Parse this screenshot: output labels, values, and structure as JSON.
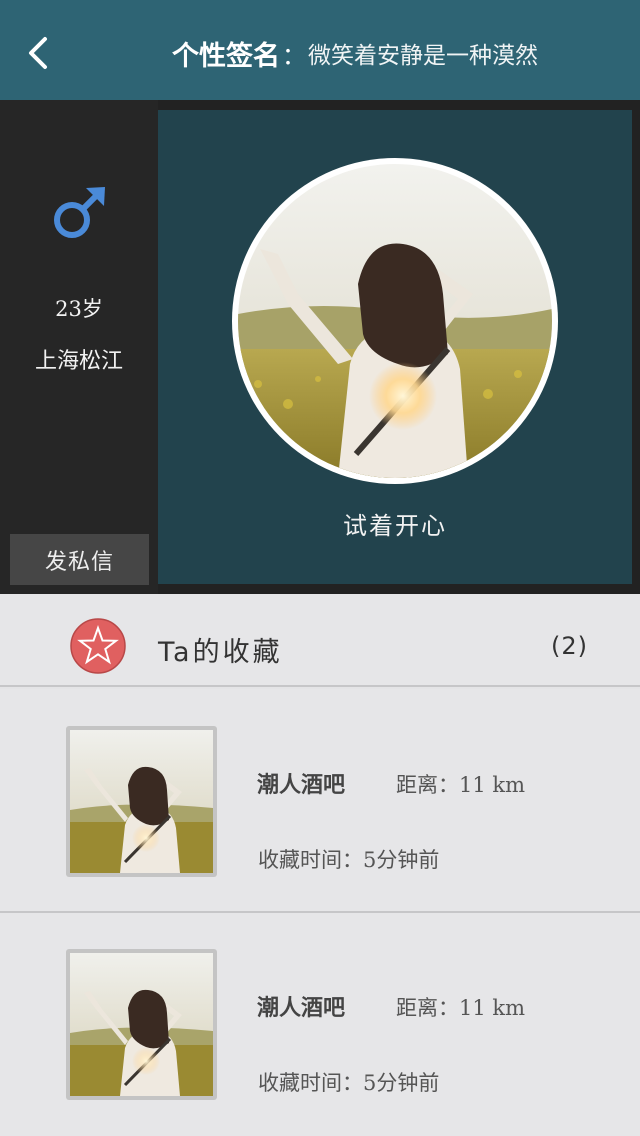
{
  "header": {
    "back_icon": "chevron-left-icon",
    "signature_label": "个性签名",
    "signature_colon": "：",
    "signature_text": "微笑着安静是一种漠然"
  },
  "profile": {
    "gender_icon": "male-icon",
    "gender_color": "#4a8ad8",
    "age": "23岁",
    "location": "上海松江",
    "message_button": "发私信",
    "motto": "试着开心"
  },
  "favorites": {
    "star_icon": "star-icon",
    "star_color": "#e06060",
    "title": "Ta的收藏",
    "count": "(2)",
    "items": [
      {
        "name": "潮人酒吧",
        "distance": "距离：11 km",
        "time": "收藏时间：5分钟前"
      },
      {
        "name": "潮人酒吧",
        "distance": "距离：11 km",
        "time": "收藏时间：5分钟前"
      }
    ]
  },
  "colors": {
    "header_bg": "#2e6474",
    "panel_bg": "#22434d",
    "dark_bg": "#262626"
  }
}
